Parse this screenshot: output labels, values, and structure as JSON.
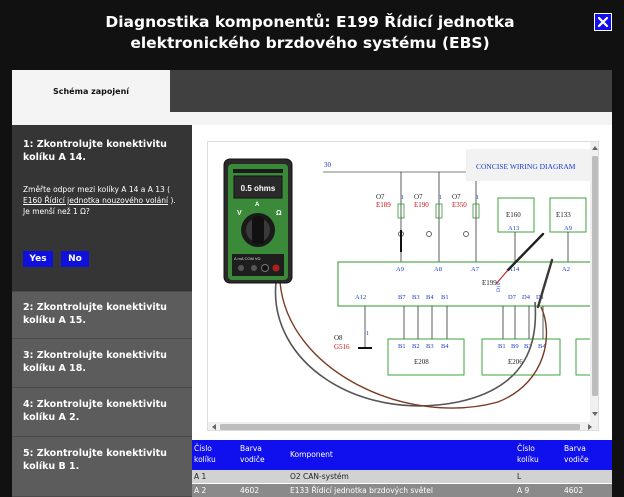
{
  "dialog": {
    "title": "Diagnostika komponentů: E199 Řídicí jednotka elektronického brzdového systému (EBS)"
  },
  "tabs": [
    {
      "label": "Schéma zapojení"
    }
  ],
  "steps": [
    {
      "title": "1: Zkontrolujte konektivitu kolíku A 14.",
      "body_pre": "Změřte odpor mezi kolíky A 14 a A 13 (",
      "body_link": "E160 Řídicí jednotka nouzového volání",
      "body_post": "). Je menší než 1 Ω?",
      "yes_label": "Yes",
      "no_label": "No"
    },
    {
      "title": "2: Zkontrolujte konektivitu kolíku A 15."
    },
    {
      "title": "3: Zkontrolujte konektivitu kolíku A 18."
    },
    {
      "title": "4: Zkontrolujte konektivitu kolíku A 2."
    },
    {
      "title": "5: Zkontrolujte konektivitu kolíku B 1."
    }
  ],
  "diagram": {
    "badge": "CONCISE WIRING DIAGRAM",
    "multimeter": {
      "reading": "0.5 ohms",
      "mode_v": "V",
      "mode_a": "A",
      "mode_ohm": "Ω",
      "jack_labels": "A  mA  COM  VΩ"
    },
    "line_number": "30",
    "fuses": [
      {
        "name": "O7",
        "code": "E189",
        "pin": "1"
      },
      {
        "name": "O7",
        "code": "E190",
        "pin": "1"
      },
      {
        "name": "O7",
        "code": "E350",
        "pin": "1"
      }
    ],
    "modules_top": [
      {
        "name": "E160",
        "pin": "A13"
      },
      {
        "name": "E133",
        "pin": "A9"
      }
    ],
    "bus_pins_top": [
      "A9",
      "A8",
      "A7",
      "A14",
      "A2"
    ],
    "main_unit": "E199",
    "bus_pins_bottom_left": [
      "A12"
    ],
    "bus_pins_bottom": [
      "B7",
      "B3",
      "B4",
      "B1"
    ],
    "bus_pins_bottom_right": [
      "D7",
      "D4",
      "D1"
    ],
    "side_pin": "D10",
    "ground": {
      "name": "O8",
      "code": "G516",
      "pin": "1"
    },
    "modules_bottom": [
      {
        "name": "E208",
        "pins": [
          "B1",
          "B2",
          "B3",
          "B4"
        ]
      },
      {
        "name": "E206",
        "pins": [
          "B1",
          "B9",
          "B3",
          "B4"
        ]
      }
    ]
  },
  "table": {
    "headers": [
      "Číslo kolíku",
      "Barva vodiče",
      "Komponent",
      "Číslo kolíku",
      "Barva vodiče"
    ],
    "rows": [
      [
        "A 1",
        "",
        "O2 CAN-systém",
        "L",
        ""
      ],
      [
        "A 2",
        "4602",
        "E133 Řídicí jednotka brzdových světel",
        "A 9",
        "4602"
      ]
    ]
  }
}
